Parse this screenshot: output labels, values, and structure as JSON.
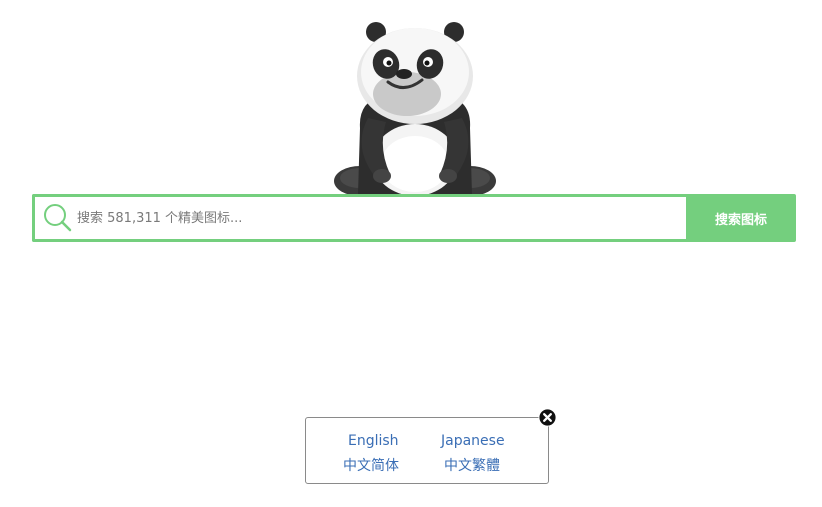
{
  "mascot": {
    "icon": "panda-mascot-icon"
  },
  "search": {
    "placeholder": "搜索 581,311 个精美图标...",
    "button_label": "搜索图标",
    "icon": "search-icon",
    "accent_color": "#74cf7e"
  },
  "language_popup": {
    "options": [
      {
        "label": "English"
      },
      {
        "label": "Japanese"
      },
      {
        "label": "中文简体"
      },
      {
        "label": "中文繁體"
      }
    ],
    "close_icon": "close-icon",
    "link_color": "#3a6eb5"
  }
}
